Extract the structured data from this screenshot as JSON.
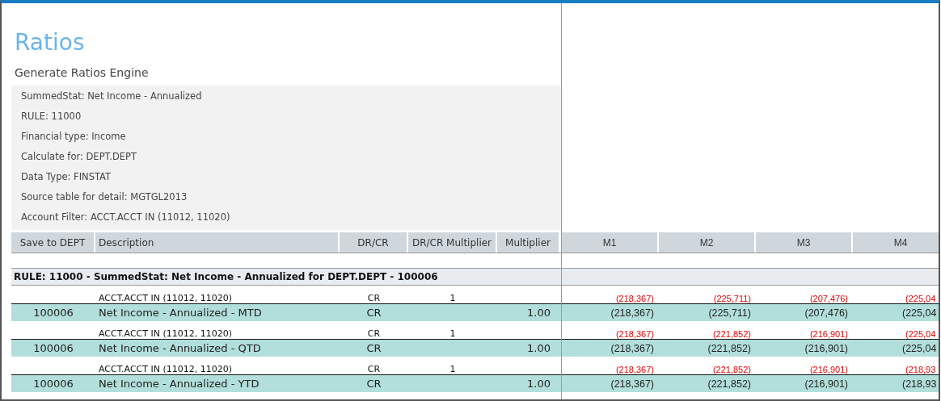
{
  "title": "Ratios",
  "subtitle": "Generate Ratios Engine",
  "info_lines": [
    "SummedStat: Net Income - Annualized",
    "RULE: 11000",
    "Financial type: Income",
    "Calculate for: DEPT.DEPT",
    "Data Type: FINSTAT",
    "Source table for detail: MGTGL2013",
    "Account Filter: ACCT.ACCT IN (11012, 11020)"
  ],
  "table": {
    "columns": [
      "Save to DEPT",
      "Description",
      "DR/CR",
      "DR/CR Multiplier",
      "Multiplier",
      "M1",
      "M2",
      "M3",
      "M4"
    ],
    "group_header": "RULE: 11000 - SummedStat: Net Income - Annualized for DEPT.DEPT - 100006",
    "rows": [
      {
        "kind": "detail",
        "description": "ACCT.ACCT IN (11012, 11020)",
        "drcr": "CR",
        "drcr_multiplier": "1",
        "values": [
          "(218,367)",
          "(225,711)",
          "(207,476)",
          "(225,04"
        ]
      },
      {
        "kind": "total",
        "save_to": "100006",
        "description": "Net Income - Annualized - MTD",
        "drcr": "CR",
        "multiplier": "1.00",
        "values": [
          "(218,367)",
          "(225,711)",
          "(207,476)",
          "(225,04"
        ]
      },
      {
        "kind": "detail",
        "description": "ACCT.ACCT IN (11012, 11020)",
        "drcr": "CR",
        "drcr_multiplier": "1",
        "values": [
          "(218,367)",
          "(221,852)",
          "(216,901)",
          "(225,04"
        ]
      },
      {
        "kind": "total",
        "save_to": "100006",
        "description": "Net Income - Annualized - QTD",
        "drcr": "CR",
        "multiplier": "1.00",
        "values": [
          "(218,367)",
          "(221,852)",
          "(216,901)",
          "(225,04"
        ]
      },
      {
        "kind": "detail",
        "description": "ACCT.ACCT IN (11012, 11020)",
        "drcr": "CR",
        "drcr_multiplier": "1",
        "values": [
          "(218,367)",
          "(221,852)",
          "(216,901)",
          "(218,93"
        ]
      },
      {
        "kind": "total",
        "save_to": "100006",
        "description": "Net Income - Annualized - YTD",
        "drcr": "CR",
        "multiplier": "1.00",
        "values": [
          "(218,367)",
          "(221,852)",
          "(216,901)",
          "(218,93"
        ]
      }
    ]
  }
}
